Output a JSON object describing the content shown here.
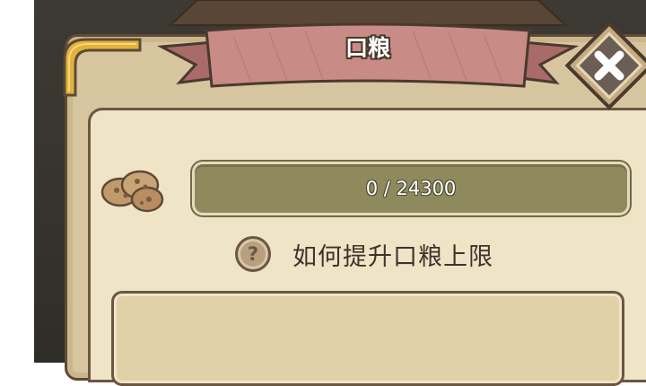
{
  "dialog": {
    "title": "口粮",
    "close_icon": "close-x-icon"
  },
  "ration": {
    "icon": "cookie-ration-icon",
    "current": 0,
    "max": 24300,
    "label": "0 / 24300"
  },
  "help": {
    "icon": "question-mark-icon",
    "label": "如何提升口粮上限"
  },
  "colors": {
    "panel": "#d7c59f",
    "panel_inner": "#efe4c6",
    "banner": "#c98b86",
    "bar": "#8e8a5e",
    "outline": "#5d4a37",
    "gold": "#e3b23c"
  }
}
